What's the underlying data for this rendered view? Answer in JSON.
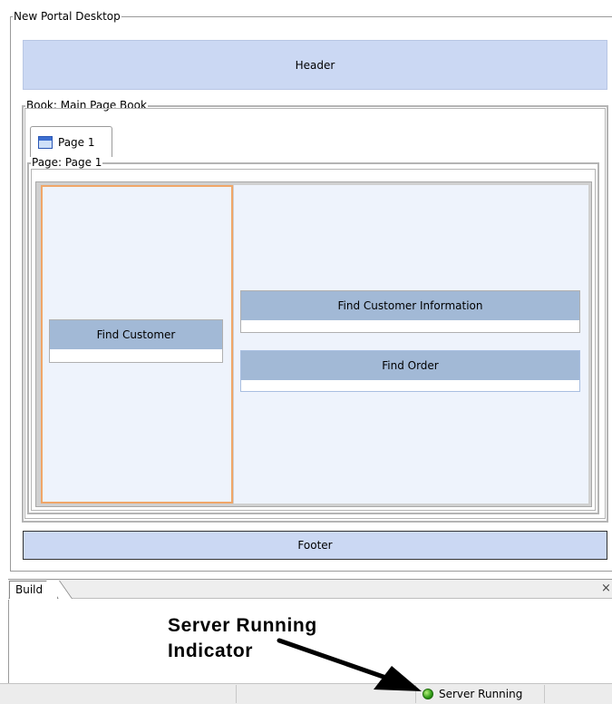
{
  "desktop": {
    "legend": "New Portal Desktop"
  },
  "header": {
    "label": "Header"
  },
  "book": {
    "legend": "Book: Main Page Book",
    "tab_label": "Page 1"
  },
  "page": {
    "legend": "Page: Page 1"
  },
  "portlets": {
    "find_customer": "Find Customer",
    "find_customer_info": "Find Customer Information",
    "find_order": "Find Order"
  },
  "footer": {
    "label": "Footer"
  },
  "build_panel": {
    "tab_label": "Build",
    "close_glyph": "×"
  },
  "callout": {
    "line1": "Server Running",
    "line2": "Indicator"
  },
  "status_bar": {
    "server_status": "Server Running",
    "indicator_color": "#2f9a16"
  }
}
